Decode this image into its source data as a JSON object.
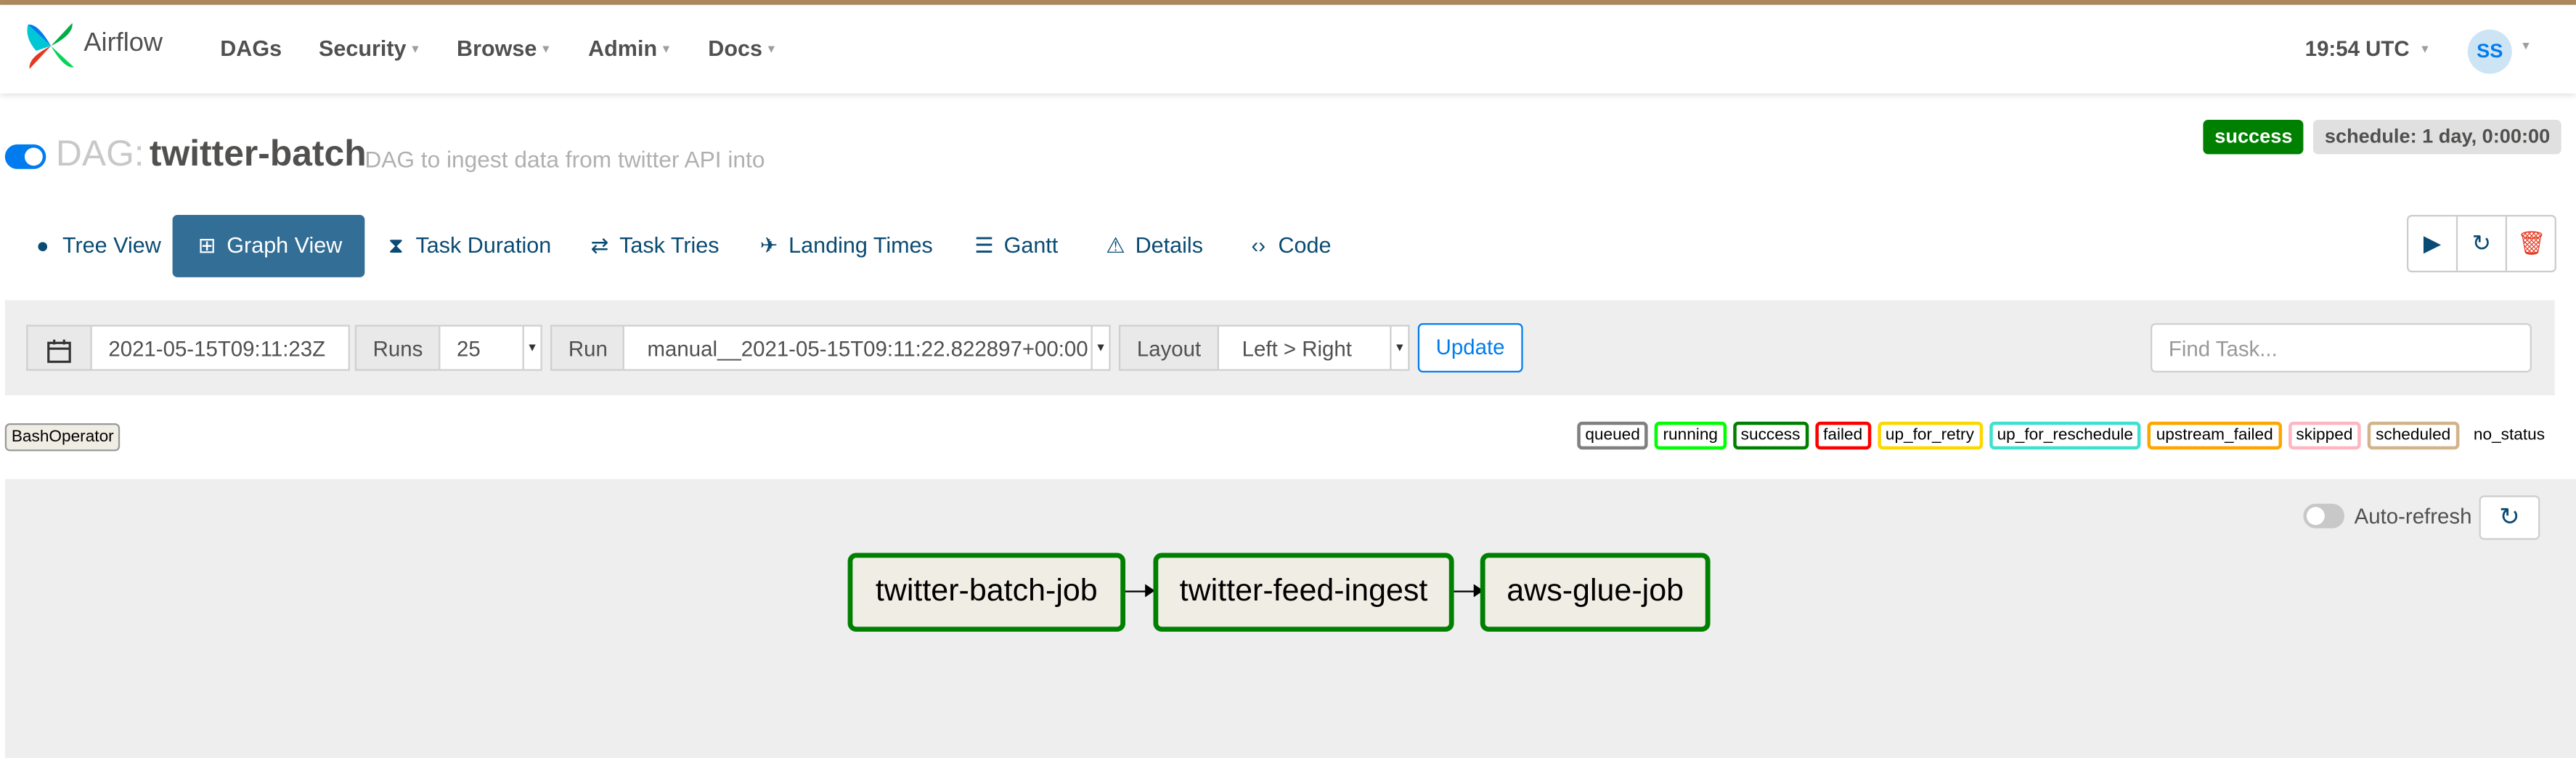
{
  "navbar": {
    "brand": "Airflow",
    "menu": [
      {
        "label": "DAGs",
        "has_caret": false
      },
      {
        "label": "Security",
        "has_caret": true
      },
      {
        "label": "Browse",
        "has_caret": true
      },
      {
        "label": "Admin",
        "has_caret": true
      },
      {
        "label": "Docs",
        "has_caret": true
      }
    ],
    "clock": "19:54 UTC",
    "user_initials": "SS"
  },
  "dag": {
    "prefix": "DAG:",
    "id": "twitter-batch",
    "description": "DAG to ingest data from twitter API into",
    "paused": false,
    "state_badge": "success",
    "schedule_badge": "schedule: 1 day, 0:00:00"
  },
  "tabs": [
    {
      "label": "Tree View",
      "icon": "pin-icon",
      "active": false
    },
    {
      "label": "Graph View",
      "icon": "graph-icon",
      "active": true
    },
    {
      "label": "Task Duration",
      "icon": "hourglass-icon",
      "active": false
    },
    {
      "label": "Task Tries",
      "icon": "retry-icon",
      "active": false
    },
    {
      "label": "Landing Times",
      "icon": "plane-landing-icon",
      "active": false
    },
    {
      "label": "Gantt",
      "icon": "gantt-icon",
      "active": false
    },
    {
      "label": "Details",
      "icon": "warning-triangle-icon",
      "active": false
    },
    {
      "label": "Code",
      "icon": "code-icon",
      "active": false
    }
  ],
  "controls": {
    "base_date": "2021-05-15T09:11:23Z",
    "runs_label": "Runs",
    "runs_value": "25",
    "run_label": "Run",
    "run_value": "manual__2021-05-15T09:11:22.822897+00:00",
    "layout_label": "Layout",
    "layout_value": "Left > Right",
    "update_label": "Update",
    "find_placeholder": "Find Task..."
  },
  "operator_legend": "BashOperator",
  "state_legend": [
    {
      "label": "queued",
      "color": "#808080"
    },
    {
      "label": "running",
      "color": "#00ff00"
    },
    {
      "label": "success",
      "color": "#008000"
    },
    {
      "label": "failed",
      "color": "#ff0000"
    },
    {
      "label": "up_for_retry",
      "color": "#ffd700"
    },
    {
      "label": "up_for_reschedule",
      "color": "#40e0d0"
    },
    {
      "label": "upstream_failed",
      "color": "#ffa500"
    },
    {
      "label": "skipped",
      "color": "#ffb6c1"
    },
    {
      "label": "scheduled",
      "color": "#d2b48c"
    },
    {
      "label": "no_status",
      "color": "#ffffff"
    }
  ],
  "graph": {
    "auto_refresh_label": "Auto-refresh",
    "auto_refresh_on": false,
    "tasks": [
      {
        "label": "twitter-batch-job",
        "state": "success"
      },
      {
        "label": "twitter-feed-ingest",
        "state": "success"
      },
      {
        "label": "aws-glue-job",
        "state": "success"
      }
    ]
  },
  "colors": {
    "primary": "#017cee",
    "tab_active": "#336e96",
    "success": "#008000",
    "node_fill": "#f0ede4"
  }
}
